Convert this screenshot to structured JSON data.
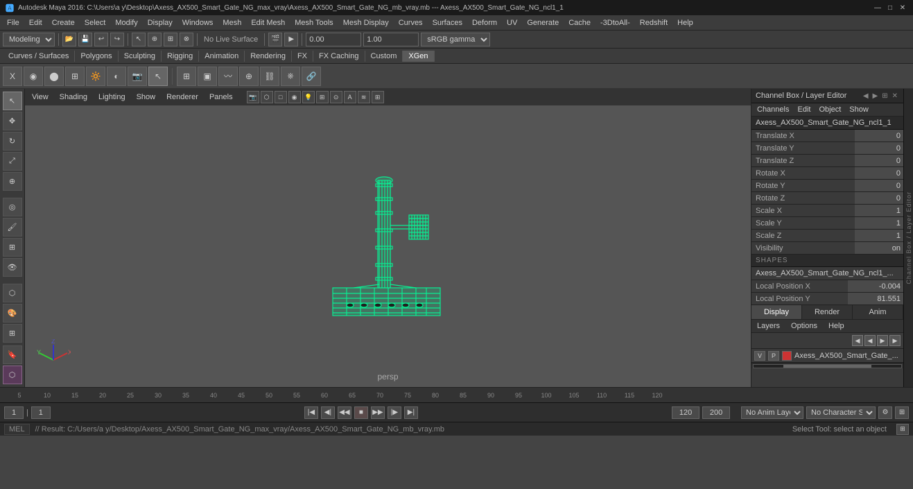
{
  "titlebar": {
    "title": "Autodesk Maya 2016: C:\\Users\\a y\\Desktop\\Axess_AX500_Smart_Gate_NG_max_vray\\Axess_AX500_Smart_Gate_NG_mb_vray.mb --- Axess_AX500_Smart_Gate_NG_ncl1_1",
    "logo": "🅰",
    "min": "—",
    "max": "□",
    "close": "✕"
  },
  "menubar": {
    "items": [
      "File",
      "Edit",
      "Create",
      "Select",
      "Modify",
      "Display",
      "Windows",
      "Mesh",
      "Edit Mesh",
      "Mesh Tools",
      "Mesh Display",
      "Curves",
      "Surfaces",
      "Deform",
      "UV",
      "Generate",
      "Cache",
      "-3DtoAll-",
      "Redshift",
      "Help"
    ]
  },
  "toolbar1": {
    "workspace_select": "Modeling",
    "gamma_label": "sRGB gamma",
    "value1": "0.00",
    "value2": "1.00"
  },
  "shelf": {
    "items": [
      "Curves / Surfaces",
      "Polygons",
      "Sculpting",
      "Rigging",
      "Animation",
      "Rendering",
      "FX",
      "FX Caching",
      "Custom",
      "XGen"
    ]
  },
  "viewport": {
    "menus": [
      "View",
      "Shading",
      "Lighting",
      "Show",
      "Renderer",
      "Panels"
    ],
    "persp_label": "persp"
  },
  "channel_box": {
    "title": "Channel Box / Layer Editor",
    "menus": [
      "Channels",
      "Edit",
      "Object",
      "Show"
    ],
    "object_name": "Axess_AX500_Smart_Gate_NG_ncl1_1",
    "channels": [
      {
        "label": "Translate X",
        "value": "0"
      },
      {
        "label": "Translate Y",
        "value": "0"
      },
      {
        "label": "Translate Z",
        "value": "0"
      },
      {
        "label": "Rotate X",
        "value": "0"
      },
      {
        "label": "Rotate Y",
        "value": "0"
      },
      {
        "label": "Rotate Z",
        "value": "0"
      },
      {
        "label": "Scale X",
        "value": "1"
      },
      {
        "label": "Scale Y",
        "value": "1"
      },
      {
        "label": "Scale Z",
        "value": "1"
      },
      {
        "label": "Visibility",
        "value": "on"
      }
    ],
    "shapes_section": "SHAPES",
    "shapes_name": "Axess_AX500_Smart_Gate_NG_ncl1_...",
    "local_positions": [
      {
        "label": "Local Position X",
        "value": "-0.004"
      },
      {
        "label": "Local Position Y",
        "value": "81.551"
      }
    ]
  },
  "dra_tabs": [
    "Display",
    "Render",
    "Anim"
  ],
  "layers": {
    "menus": [
      "Layers",
      "Options",
      "Help"
    ],
    "entries": [
      {
        "v": "V",
        "p": "P",
        "color": "#cc3333",
        "name": "Axess_AX500_Smart_Gate_..."
      }
    ]
  },
  "timeline": {
    "ticks": [
      "5",
      "10",
      "15",
      "20",
      "25",
      "30",
      "35",
      "40",
      "45",
      "50",
      "55",
      "60",
      "65",
      "70",
      "75",
      "80",
      "85",
      "90",
      "95",
      "100",
      "105",
      "110",
      "115",
      "120"
    ]
  },
  "playback": {
    "current_frame_left": "1",
    "current_frame_right": "1",
    "input_frame": "1",
    "end_time": "120",
    "max_time": "200",
    "anim_layer": "No Anim Layer",
    "char_set": "No Character Set"
  },
  "statusbar": {
    "mode_label": "MEL",
    "result_text": "// Result: C:/Users/a y/Desktop/Axess_AX500_Smart_Gate_NG_max_vray/Axess_AX500_Smart_Gate_NG_mb_vray.mb",
    "select_text": "Select Tool: select an object"
  },
  "attr_strip_label": "Channel Box / Layer Editor"
}
